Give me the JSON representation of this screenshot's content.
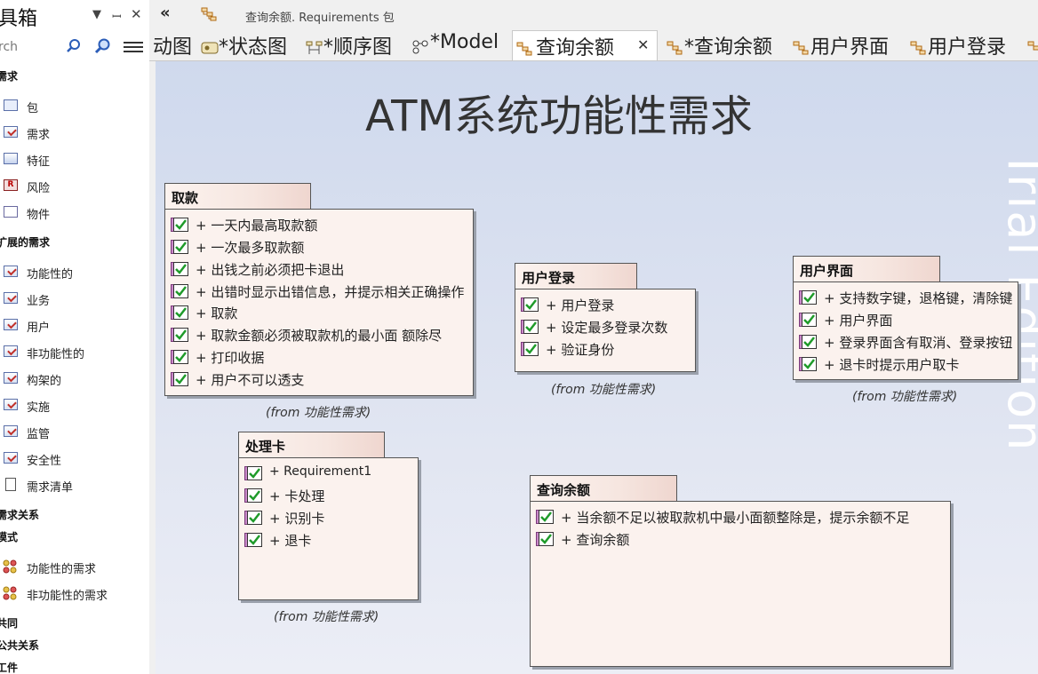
{
  "toolbox": {
    "title": "具箱",
    "search_value": "rch",
    "groups": [
      {
        "label": "需求"
      },
      {
        "label": "扩展的需求"
      },
      {
        "label": "需求关系"
      },
      {
        "label": "模式"
      },
      {
        "label": "共同"
      },
      {
        "label": "公共关系"
      },
      {
        "label": "工件"
      }
    ],
    "items": [
      {
        "label": "包",
        "icon": "package-icon"
      },
      {
        "label": "需求",
        "icon": "requirement-icon"
      },
      {
        "label": "特征",
        "icon": "feature-icon"
      },
      {
        "label": "风险",
        "icon": "risk-icon"
      },
      {
        "label": "物件",
        "icon": "artifact-icon"
      },
      {
        "label": "功能性的",
        "icon": "requirement-icon"
      },
      {
        "label": "业务",
        "icon": "requirement-icon"
      },
      {
        "label": "用户",
        "icon": "requirement-icon"
      },
      {
        "label": "非功能性的",
        "icon": "requirement-icon"
      },
      {
        "label": "构架的",
        "icon": "requirement-icon"
      },
      {
        "label": "实施",
        "icon": "requirement-icon"
      },
      {
        "label": "监管",
        "icon": "requirement-icon"
      },
      {
        "label": "安全性",
        "icon": "requirement-icon"
      },
      {
        "label": "需求清单",
        "icon": "list-icon"
      },
      {
        "label": "功能性的需求",
        "icon": "pattern-icon"
      },
      {
        "label": "非功能性的需求",
        "icon": "pattern-icon"
      }
    ]
  },
  "header": {
    "breadcrumb": "查询余额.  Requirements 包"
  },
  "tabs": [
    {
      "label": "动图"
    },
    {
      "label": "*状态图"
    },
    {
      "label": "*顺序图"
    },
    {
      "label": "*Model"
    },
    {
      "label": "查询余额",
      "active": true
    },
    {
      "label": "*查询余额"
    },
    {
      "label": "用户界面"
    },
    {
      "label": "用户登录"
    }
  ],
  "diagram": {
    "title": "ATM系统功能性需求",
    "watermark": "Trial Edition",
    "packages": [
      {
        "name": "取款",
        "items": [
          "+ 一天内最高取款额",
          "+ 一次最多取款额",
          "+ 出钱之前必须把卡退出",
          "+ 出错时显示出错信息，并提示相关正确操作",
          "+ 取款",
          "+ 取款金额必须被取款机的最小面 额除尽",
          "+ 打印收据",
          "+ 用户不可以透支"
        ],
        "from": "(from 功能性需求)"
      },
      {
        "name": "用户登录",
        "items": [
          "+ 用户登录",
          "+ 设定最多登录次数",
          "+ 验证身份"
        ],
        "from": "(from 功能性需求)"
      },
      {
        "name": "用户界面",
        "items": [
          "+ 支持数字键，退格键，清除键",
          "+ 用户界面",
          "+ 登录界面含有取消、登录按钮",
          "+ 退卡时提示用户取卡"
        ],
        "from": "(from 功能性需求)"
      },
      {
        "name": "处理卡",
        "items": [
          "+ Requirement1",
          "+ 卡处理",
          "+ 识别卡",
          "+ 退卡"
        ],
        "from": "(from 功能性需求)"
      },
      {
        "name": "查询余额",
        "items": [
          "+ 当余额不足以被取款机中最小面额整除是，提示余额不足",
          "+ 查询余额"
        ],
        "from": ""
      }
    ]
  },
  "colors": {
    "canvas_top": "#cfd9ed",
    "package_fill": "#fbf2ee",
    "check_green": "#1f9b2a"
  }
}
